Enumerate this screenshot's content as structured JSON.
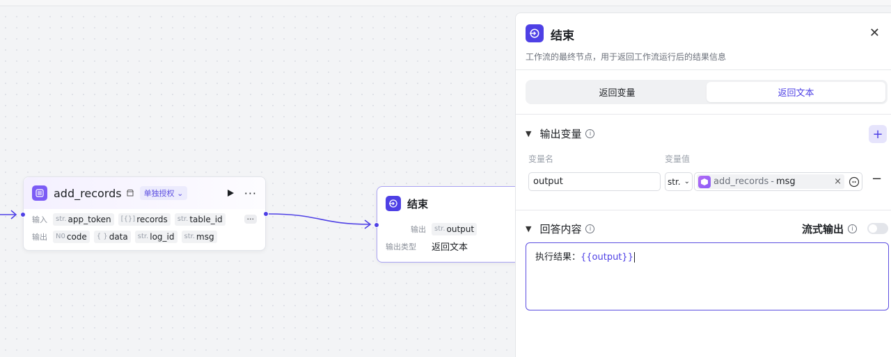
{
  "add_records_node": {
    "title": "add_records",
    "auth_badge": "单独授权",
    "input_label": "输入",
    "output_label": "输出",
    "inputs": [
      {
        "type": "str.",
        "name": "app_token"
      },
      {
        "type": "[{}]",
        "name": "records"
      },
      {
        "type": "str.",
        "name": "table_id"
      }
    ],
    "outputs": [
      {
        "type": "N0",
        "name": "code"
      },
      {
        "type": "{ }",
        "name": "data"
      },
      {
        "type": "str.",
        "name": "log_id"
      },
      {
        "type": "str.",
        "name": "msg"
      }
    ],
    "more_inputs": "···"
  },
  "end_node": {
    "title": "结束",
    "output_label": "输出",
    "output_type": "str.",
    "output_name": "output",
    "output_kind_label": "输出类型",
    "output_kind_value": "返回文本"
  },
  "panel": {
    "title": "结束",
    "description": "工作流的最终节点，用于返回工作流运行后的结果信息",
    "close": "✕",
    "tabs": [
      {
        "label": "返回变量",
        "active": false
      },
      {
        "label": "返回文本",
        "active": true
      }
    ],
    "output_section": {
      "title": "输出变量",
      "add": "+",
      "col_name": "变量名",
      "col_value": "变量值",
      "variable_name": "output",
      "type_select": "str.",
      "ref_node": "add_records",
      "ref_sep": "-",
      "ref_field": "msg",
      "clear": "×",
      "remove": "−"
    },
    "answer_section": {
      "title": "回答内容",
      "stream_label": "流式输出",
      "stream_enabled": false,
      "text_prefix": "执行结果：",
      "text_var": "{{output}}"
    }
  },
  "colors": {
    "accent": "#4e40e5",
    "node_icon": "#7c5cf5"
  }
}
